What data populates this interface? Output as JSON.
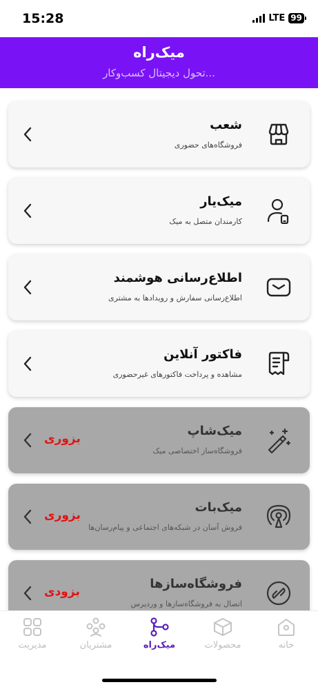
{
  "status_bar": {
    "time": "15:28",
    "network": "LTE",
    "battery": "99"
  },
  "header": {
    "title": "میک‌راه",
    "subtitle": "تحول دیجیتال کسب‌وکار..."
  },
  "items": [
    {
      "title": "شعب",
      "description": "فروشگاه‌های حضوری",
      "icon": "store-icon",
      "enabled": true,
      "badge": ""
    },
    {
      "title": "میک‌یار",
      "description": "کارمندان متصل به میک",
      "icon": "user-phone-icon",
      "enabled": true,
      "badge": ""
    },
    {
      "title": "اطلاع‌رسانی هوشمند",
      "description": "اطلاع‌رسانی سفارش و رویدادها به مشتری",
      "icon": "envelope-icon",
      "enabled": true,
      "badge": ""
    },
    {
      "title": "فاکتور آنلاین",
      "description": "مشاهده و پرداخت فاکتورهای غیرحضوری",
      "icon": "receipt-icon",
      "enabled": true,
      "badge": ""
    },
    {
      "title": "میک‌شاپ",
      "description": "فروشگاه‌ساز اختصاصی میک",
      "icon": "magic-wand-icon",
      "enabled": false,
      "badge": "بزوری"
    },
    {
      "title": "میک‌بات",
      "description": "فروش آسان در شبکه‌های اجتماعی و پیام‌رسان‌ها",
      "icon": "broadcast-icon",
      "enabled": false,
      "badge": "بزوری"
    },
    {
      "title": "فروشگاه‌سازها",
      "description": "اتصال به فروشگاه‌سازها و وردپرس",
      "icon": "link-icon",
      "enabled": false,
      "badge": "بزودی"
    }
  ],
  "nav": [
    {
      "label": "خانه",
      "icon": "home-icon",
      "active": false
    },
    {
      "label": "محصولات",
      "icon": "box-icon",
      "active": false
    },
    {
      "label": "میک‌راه",
      "icon": "route-icon",
      "active": true
    },
    {
      "label": "مشتریان",
      "icon": "customers-icon",
      "active": false
    },
    {
      "label": "مدیریت",
      "icon": "grid-icon",
      "active": false
    }
  ],
  "colors": {
    "header": "#7a12f6",
    "active_nav": "#5a1fb8",
    "badge": "#e01414",
    "disabled_card": "#a8a8a8"
  }
}
